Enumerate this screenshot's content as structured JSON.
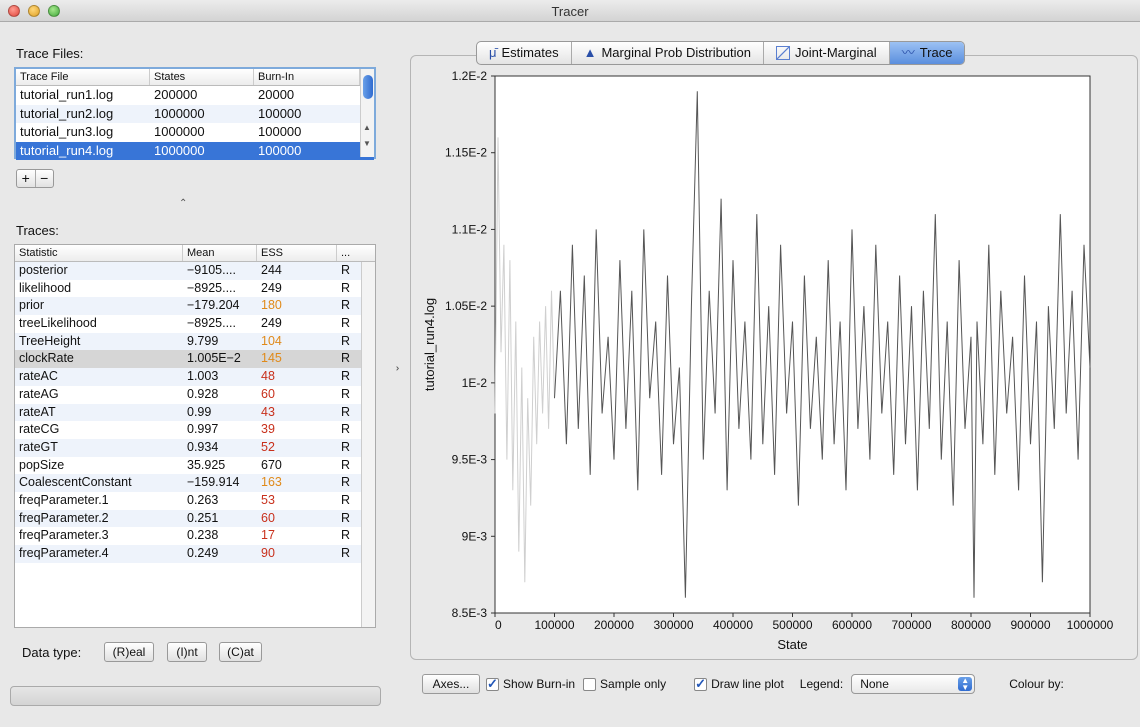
{
  "window": {
    "title": "Tracer"
  },
  "trace_files": {
    "label": "Trace Files:",
    "columns": [
      "Trace File",
      "States",
      "Burn-In"
    ],
    "rows": [
      [
        "tutorial_run1.log",
        "200000",
        "20000"
      ],
      [
        "tutorial_run2.log",
        "1000000",
        "100000"
      ],
      [
        "tutorial_run3.log",
        "1000000",
        "100000"
      ],
      [
        "tutorial_run4.log",
        "1000000",
        "100000"
      ]
    ],
    "selected_index": 3,
    "add_label": "+",
    "remove_label": "−"
  },
  "traces": {
    "label": "Traces:",
    "columns": [
      "Statistic",
      "Mean",
      "ESS",
      "..."
    ],
    "rows": [
      {
        "stat": "posterior",
        "mean": "−9105....",
        "ess": "244",
        "ess_level": "ok",
        "flag": "R"
      },
      {
        "stat": "likelihood",
        "mean": "−8925....",
        "ess": "249",
        "ess_level": "ok",
        "flag": "R"
      },
      {
        "stat": "prior",
        "mean": "−179.204",
        "ess": "180",
        "ess_level": "warn",
        "flag": "R"
      },
      {
        "stat": "treeLikelihood",
        "mean": "−8925....",
        "ess": "249",
        "ess_level": "ok",
        "flag": "R"
      },
      {
        "stat": "TreeHeight",
        "mean": "9.799",
        "ess": "104",
        "ess_level": "warn",
        "flag": "R"
      },
      {
        "stat": "clockRate",
        "mean": "1.005E−2",
        "ess": "145",
        "ess_level": "warn",
        "flag": "R"
      },
      {
        "stat": "rateAC",
        "mean": "1.003",
        "ess": "48",
        "ess_level": "bad",
        "flag": "R"
      },
      {
        "stat": "rateAG",
        "mean": "0.928",
        "ess": "60",
        "ess_level": "bad",
        "flag": "R"
      },
      {
        "stat": "rateAT",
        "mean": "0.99",
        "ess": "43",
        "ess_level": "bad",
        "flag": "R"
      },
      {
        "stat": "rateCG",
        "mean": "0.997",
        "ess": "39",
        "ess_level": "bad",
        "flag": "R"
      },
      {
        "stat": "rateGT",
        "mean": "0.934",
        "ess": "52",
        "ess_level": "bad",
        "flag": "R"
      },
      {
        "stat": "popSize",
        "mean": "35.925",
        "ess": "670",
        "ess_level": "ok",
        "flag": "R"
      },
      {
        "stat": "CoalescentConstant",
        "mean": "−159.914",
        "ess": "163",
        "ess_level": "warn",
        "flag": "R"
      },
      {
        "stat": "freqParameter.1",
        "mean": "0.263",
        "ess": "53",
        "ess_level": "bad",
        "flag": "R"
      },
      {
        "stat": "freqParameter.2",
        "mean": "0.251",
        "ess": "60",
        "ess_level": "bad",
        "flag": "R"
      },
      {
        "stat": "freqParameter.3",
        "mean": "0.238",
        "ess": "17",
        "ess_level": "bad",
        "flag": "R"
      },
      {
        "stat": "freqParameter.4",
        "mean": "0.249",
        "ess": "90",
        "ess_level": "bad",
        "flag": "R"
      }
    ],
    "selected_index": 5
  },
  "data_type": {
    "label": "Data type:",
    "real": "(R)eal",
    "int": "(I)nt",
    "cat": "(C)at"
  },
  "tabs": [
    {
      "label": "Estimates",
      "icon": "estimates-icon"
    },
    {
      "label": "Marginal Prob Distribution",
      "icon": "triangle-icon"
    },
    {
      "label": "Joint-Marginal",
      "icon": "scatter-icon"
    },
    {
      "label": "Trace",
      "icon": "trace-icon",
      "active": true
    }
  ],
  "bottom_bar": {
    "axes_label": "Axes...",
    "show_burnin_label": "Show Burn-in",
    "show_burnin_checked": true,
    "sample_only_label": "Sample only",
    "sample_only_checked": false,
    "draw_line_label": "Draw line plot",
    "draw_line_checked": true,
    "legend_label": "Legend:",
    "legend_value": "None",
    "colour_label": "Colour by:"
  },
  "colors": {
    "selection": "#3875d7",
    "ess_warn": "#e08a1a",
    "ess_bad": "#c8301c",
    "trace_line": "#555555",
    "burnin_line": "#cfcfcf"
  },
  "chart_data": {
    "type": "line",
    "xlabel": "State",
    "ylabel": "tutorial_run4.log",
    "xlim": [
      0,
      1000000
    ],
    "ylim": [
      0.0085,
      0.012
    ],
    "x_ticks": [
      "0",
      "100000",
      "200000",
      "300000",
      "400000",
      "500000",
      "600000",
      "700000",
      "800000",
      "900000",
      "1000000"
    ],
    "y_ticks": [
      "8.5E-3",
      "9E-3",
      "9.5E-3",
      "1E-2",
      "1.05E-2",
      "1.1E-2",
      "1.15E-2",
      "1.2E-2"
    ],
    "burnin_end": 100000,
    "series": [
      {
        "points": [
          [
            0,
            0.0098
          ],
          [
            5000,
            0.0116
          ],
          [
            10000,
            0.0102
          ],
          [
            15000,
            0.0109
          ],
          [
            20000,
            0.0095
          ],
          [
            25000,
            0.0108
          ],
          [
            30000,
            0.0093
          ],
          [
            35000,
            0.0104
          ],
          [
            40000,
            0.0089
          ],
          [
            45000,
            0.0101
          ],
          [
            50000,
            0.0087
          ],
          [
            55000,
            0.0099
          ],
          [
            60000,
            0.0092
          ],
          [
            65000,
            0.0103
          ],
          [
            70000,
            0.0096
          ],
          [
            75000,
            0.0104
          ],
          [
            80000,
            0.0098
          ],
          [
            85000,
            0.0105
          ],
          [
            90000,
            0.0097
          ],
          [
            95000,
            0.0106
          ],
          [
            100000,
            0.0099
          ],
          [
            110000,
            0.0106
          ],
          [
            120000,
            0.0096
          ],
          [
            130000,
            0.0109
          ],
          [
            140000,
            0.0097
          ],
          [
            150000,
            0.0107
          ],
          [
            160000,
            0.0094
          ],
          [
            170000,
            0.011
          ],
          [
            180000,
            0.0098
          ],
          [
            190000,
            0.0103
          ],
          [
            200000,
            0.0095
          ],
          [
            210000,
            0.0108
          ],
          [
            220000,
            0.0097
          ],
          [
            230000,
            0.0106
          ],
          [
            240000,
            0.0093
          ],
          [
            250000,
            0.011
          ],
          [
            260000,
            0.0099
          ],
          [
            270000,
            0.0104
          ],
          [
            280000,
            0.0094
          ],
          [
            290000,
            0.0107
          ],
          [
            300000,
            0.0096
          ],
          [
            310000,
            0.0101
          ],
          [
            320000,
            0.0086
          ],
          [
            330000,
            0.0105
          ],
          [
            340000,
            0.0119
          ],
          [
            350000,
            0.0095
          ],
          [
            360000,
            0.0106
          ],
          [
            370000,
            0.0098
          ],
          [
            380000,
            0.0112
          ],
          [
            390000,
            0.0093
          ],
          [
            400000,
            0.0108
          ],
          [
            410000,
            0.0097
          ],
          [
            420000,
            0.0104
          ],
          [
            430000,
            0.0095
          ],
          [
            440000,
            0.0111
          ],
          [
            450000,
            0.0096
          ],
          [
            460000,
            0.0105
          ],
          [
            470000,
            0.0094
          ],
          [
            480000,
            0.0109
          ],
          [
            490000,
            0.0098
          ],
          [
            500000,
            0.0104
          ],
          [
            510000,
            0.0092
          ],
          [
            520000,
            0.0107
          ],
          [
            530000,
            0.0097
          ],
          [
            540000,
            0.0103
          ],
          [
            550000,
            0.0095
          ],
          [
            560000,
            0.0108
          ],
          [
            570000,
            0.0096
          ],
          [
            580000,
            0.0104
          ],
          [
            590000,
            0.0093
          ],
          [
            600000,
            0.011
          ],
          [
            610000,
            0.0097
          ],
          [
            620000,
            0.0105
          ],
          [
            630000,
            0.0095
          ],
          [
            640000,
            0.0109
          ],
          [
            650000,
            0.0098
          ],
          [
            660000,
            0.0104
          ],
          [
            670000,
            0.0094
          ],
          [
            680000,
            0.0107
          ],
          [
            690000,
            0.0096
          ],
          [
            700000,
            0.0105
          ],
          [
            710000,
            0.0093
          ],
          [
            720000,
            0.0106
          ],
          [
            730000,
            0.0097
          ],
          [
            740000,
            0.0111
          ],
          [
            750000,
            0.0095
          ],
          [
            760000,
            0.0104
          ],
          [
            770000,
            0.0092
          ],
          [
            780000,
            0.0108
          ],
          [
            790000,
            0.0097
          ],
          [
            800000,
            0.0103
          ],
          [
            805000,
            0.0086
          ],
          [
            810000,
            0.0104
          ],
          [
            820000,
            0.0096
          ],
          [
            830000,
            0.0109
          ],
          [
            840000,
            0.0094
          ],
          [
            850000,
            0.0106
          ],
          [
            860000,
            0.0098
          ],
          [
            870000,
            0.0103
          ],
          [
            880000,
            0.0093
          ],
          [
            890000,
            0.0107
          ],
          [
            900000,
            0.0096
          ],
          [
            910000,
            0.0104
          ],
          [
            920000,
            0.0087
          ],
          [
            930000,
            0.0105
          ],
          [
            940000,
            0.0097
          ],
          [
            950000,
            0.0111
          ],
          [
            960000,
            0.0098
          ],
          [
            970000,
            0.0106
          ],
          [
            980000,
            0.0095
          ],
          [
            990000,
            0.0109
          ],
          [
            1000000,
            0.0101
          ]
        ]
      }
    ]
  }
}
